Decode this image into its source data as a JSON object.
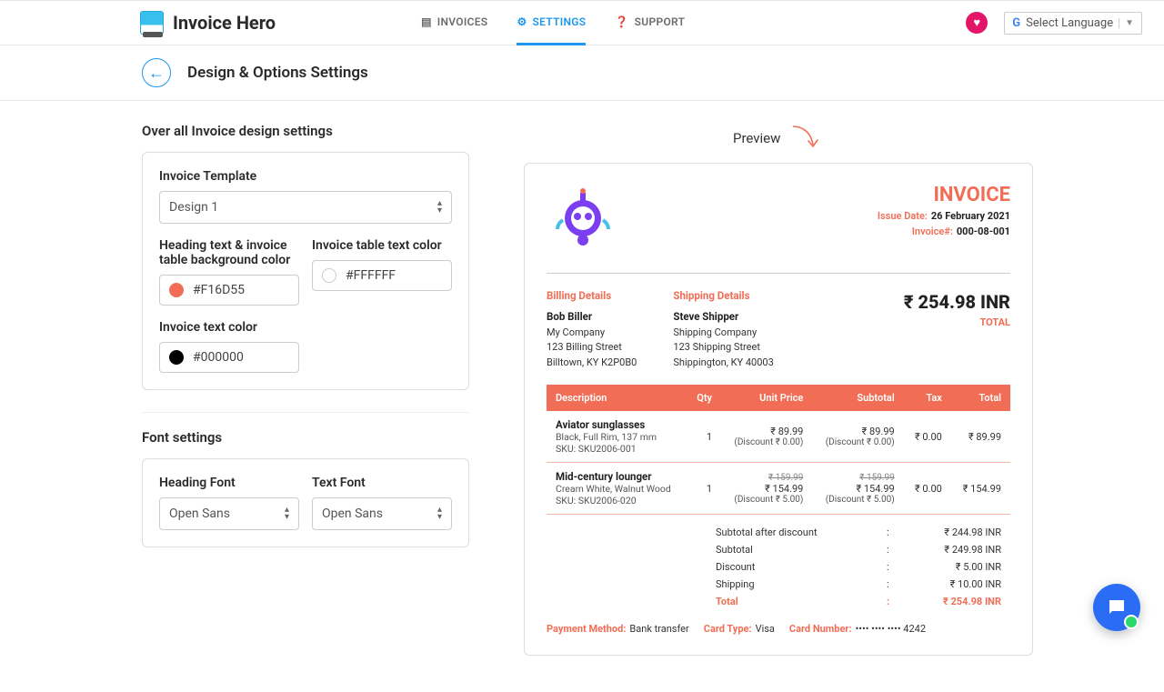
{
  "brand": "Invoice Hero",
  "nav": {
    "invoices": "INVOICES",
    "settings": "SETTINGS",
    "support": "SUPPORT"
  },
  "language_selector": "Select Language",
  "sub_header": "Design & Options Settings",
  "left": {
    "section_design": "Over all Invoice design settings",
    "template_label": "Invoice Template",
    "template_value": "Design 1",
    "color_heading_label": "Heading text & invoice table background color",
    "color_heading_value": "#F16D55",
    "color_tabletext_label": "Invoice table text color",
    "color_tabletext_value": "#FFFFFF",
    "color_text_label": "Invoice text color",
    "color_text_value": "#000000",
    "section_font": "Font settings",
    "heading_font_label": "Heading Font",
    "heading_font_value": "Open Sans",
    "text_font_label": "Text Font",
    "text_font_value": "Open Sans"
  },
  "preview_label": "Preview",
  "preview": {
    "title": "INVOICE",
    "issue_date_label": "Issue Date:",
    "issue_date": "26 February 2021",
    "invoice_no_label": "Invoice#:",
    "invoice_no": "000-08-001",
    "billing_heading": "Billing Details",
    "billing": {
      "name": "Bob Biller",
      "company": "My Company",
      "street": "123 Billing Street",
      "city": "Billtown, KY K2P0B0"
    },
    "shipping_heading": "Shipping Details",
    "shipping": {
      "name": "Steve Shipper",
      "company": "Shipping Company",
      "street": "123 Shipping Street",
      "city": "Shippington, KY 40003"
    },
    "grand_total": "₹ 254.98 INR",
    "grand_total_label": "TOTAL",
    "cols": {
      "desc": "Description",
      "qty": "Qty",
      "unit": "Unit Price",
      "sub": "Subtotal",
      "tax": "Tax",
      "tot": "Total"
    },
    "items": [
      {
        "name": "Aviator sunglasses",
        "variant": "Black, Full Rim, 137 mm",
        "sku": "SKU: SKU2006-001",
        "qty": "1",
        "unit": "₹ 89.99",
        "unit_disc": "(Discount ₹ 0.00)",
        "sub": "₹ 89.99",
        "sub_disc": "(Discount ₹ 0.00)",
        "tax": "₹ 0.00",
        "tot": "₹ 89.99"
      },
      {
        "name": "Mid-century lounger",
        "variant": "Cream White, Walnut Wood",
        "sku": "SKU: SKU2006-020",
        "qty": "1",
        "unit_orig": "₹ 159.99",
        "unit": "₹ 154.99",
        "unit_disc": "(Discount ₹ 5.00)",
        "sub_orig": "₹ 159.99",
        "sub": "₹ 154.99",
        "sub_disc": "(Discount ₹ 5.00)",
        "tax": "₹ 0.00",
        "tot": "₹ 154.99"
      }
    ],
    "summary": {
      "after_disc_label": "Subtotal after discount",
      "after_disc": "₹ 244.98 INR",
      "subtotal_label": "Subtotal",
      "subtotal": "₹ 249.98 INR",
      "discount_label": "Discount",
      "discount": "₹ 5.00 INR",
      "shipping_label": "Shipping",
      "shipping": "₹ 10.00 INR",
      "total_label": "Total",
      "total": "₹ 254.98 INR"
    },
    "payment": {
      "method_label": "Payment Method:",
      "method": "Bank transfer",
      "cardtype_label": "Card Type:",
      "cardtype": "Visa",
      "cardnum_label": "Card Number:",
      "cardnum": "•••• •••• •••• 4242"
    }
  }
}
